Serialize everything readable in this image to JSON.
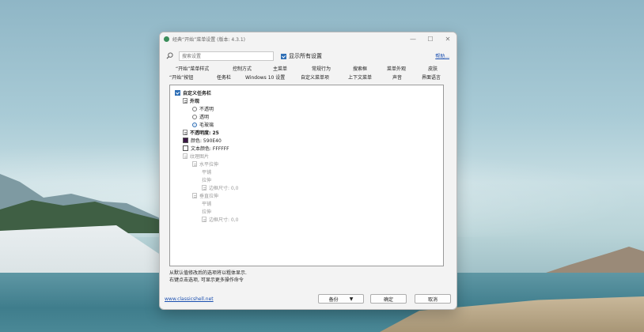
{
  "window": {
    "title": "经典“开始”菜单设置 (版本: 4.3.1)",
    "controls": [
      "—",
      "☐",
      "✕"
    ]
  },
  "search": {
    "placeholder": "搜索设置",
    "show_all_label": "显示所有设置",
    "show_all_checked": true,
    "help_label": "帮助..."
  },
  "tabs": {
    "row1": [
      "“开始”菜单样式",
      "控制方式",
      "主菜单",
      "常规行为",
      "搜索框",
      "菜单外观",
      "皮肤"
    ],
    "row2": [
      "“开始”按钮",
      "任务栏",
      "Windows 10 设置",
      "自定义菜单项",
      "上下文菜单",
      "声音",
      "界面语言"
    ],
    "active": "任务栏"
  },
  "tree": {
    "customize_taskbar": "自定义任务栏",
    "appearance": "外观",
    "opaque": "不透明",
    "transparent": "透明",
    "frosted": "毛玻璃",
    "opacity": "不透明度: 25",
    "color": "颜色: 590E40",
    "text_color": "文本颜色: FFFFFF",
    "texture": "纹理图片",
    "horizontal_stretch": "水平拉伸",
    "tile_1": "平铺",
    "stretch_1": "拉伸",
    "border_size_1": "边框尺寸: 0,0",
    "vertical_stretch": "垂直拉伸",
    "tile_2": "平铺",
    "stretch_2": "拉伸",
    "border_size_2": "边框尺寸: 0,0",
    "color_swatch": "#3b1746",
    "text_color_swatch": "#ffffff"
  },
  "status": {
    "line1": "从默认值修改后的选项将以粗体显示.",
    "line2": "右键点击选项, 可显示更多操作命令"
  },
  "footer": {
    "site": "www.classicshell.net",
    "backup": "备份",
    "ok": "确定",
    "cancel": "取消"
  }
}
